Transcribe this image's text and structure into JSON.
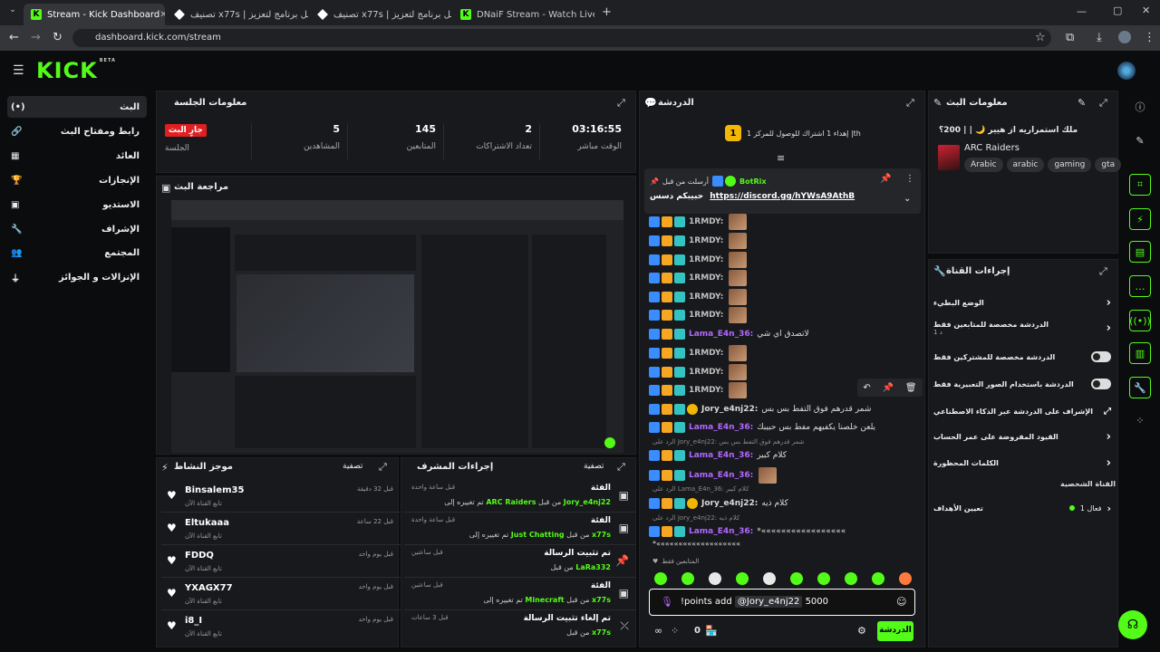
{
  "browser": {
    "tabs": [
      {
        "title": "Stream - Kick Dashboard",
        "icon": "kick-icon"
      },
      {
        "title": "تصنيف x77s | أفضل برنامج لتعزيز",
        "icon": "diamond-icon"
      },
      {
        "title": "تصنيف x77s | أفضل برنامج لتعزيز",
        "icon": "diamond-icon"
      },
      {
        "title": "DNaiF Stream - Watch Live on K",
        "icon": "kick-icon"
      }
    ],
    "url": "dashboard.kick.com/stream"
  },
  "app": {
    "logo": "KICK",
    "logo_tag": "BETA"
  },
  "sidebar": {
    "items": [
      {
        "label": "البث",
        "icon": "live-icon"
      },
      {
        "label": "رابط ومفتاح البث",
        "icon": "link-icon"
      },
      {
        "label": "العائد",
        "icon": "revenue-icon"
      },
      {
        "label": "الإنجازات",
        "icon": "trophy-icon"
      },
      {
        "label": "الاستديو",
        "icon": "studio-icon"
      },
      {
        "label": "الإشراف",
        "icon": "wrench-icon"
      },
      {
        "label": "المجتمع",
        "icon": "community-icon"
      },
      {
        "label": "الإنزالات و الجوائز",
        "icon": "drops-icon"
      }
    ]
  },
  "session": {
    "title": "معلومات الجلسة",
    "live_badge": "جارٍ البث",
    "stats": [
      {
        "value": "03:16:55",
        "label": "الوقت مباشر"
      },
      {
        "value": "2",
        "label": "تعداد الاشتراكات"
      },
      {
        "value": "145",
        "label": "المتابعين"
      },
      {
        "value": "5",
        "label": "المشاهدين"
      },
      {
        "value": "",
        "label": "الجلسة"
      }
    ]
  },
  "preview": {
    "title": "مراجعة البث"
  },
  "activity": {
    "title": "موجز النشاط",
    "filter": "تصفية",
    "items": [
      {
        "name": "Binsalem35",
        "sub": "تابع القناة الآن",
        "time": "قبل 32 دقيقة"
      },
      {
        "name": "Eltukaaa",
        "sub": "تابع القناة الآن",
        "time": "قبل 22 ساعة"
      },
      {
        "name": "FDDQ",
        "sub": "تابع القناة الآن",
        "time": "قبل يوم واحد"
      },
      {
        "name": "YXAGX77",
        "sub": "تابع القناة الآن",
        "time": "قبل يوم واحد"
      },
      {
        "name": "i8_I",
        "sub": "تابع القناة الآن",
        "time": "قبل يوم واحد"
      }
    ]
  },
  "mod_actions": {
    "title": "إجراءات المشرف",
    "filter": "تصفية",
    "items": [
      {
        "title": "الفئة",
        "line_pre": "تم تغييره إلى",
        "highlight": "ARC Raiders",
        "line_post": "من قبل",
        "by": "Jory_e4nj22",
        "time": "قبل ساعة واحدة",
        "icon": "category-icon"
      },
      {
        "title": "الفئة",
        "line_pre": "تم تغييره إلى",
        "highlight": "Just Chatting",
        "line_post": "من قبل",
        "by": "x77s",
        "time": "قبل ساعة واحدة",
        "icon": "category-icon"
      },
      {
        "title": "تم تثبيت الرسالة",
        "line_pre": "",
        "highlight": "",
        "line_post": "من قبل",
        "by": "LaRa332",
        "time": "قبل ساعتين",
        "icon": "pin-icon"
      },
      {
        "title": "الفئة",
        "line_pre": "تم تغييره إلى",
        "highlight": "Minecraft",
        "line_post": "من قبل",
        "by": "x77s",
        "time": "قبل ساعتين",
        "icon": "category-icon"
      },
      {
        "title": "تم إلغاء تثبيت الرسالة",
        "line_pre": "",
        "highlight": "",
        "line_post": "من قبل",
        "by": "x77s",
        "time": "قبل 3 ساعات",
        "icon": "unpin-icon"
      }
    ]
  },
  "chat": {
    "title": "الدردشة",
    "sub_goal": "إهداء 1 اشتراك للوصول للمركز 1 |th",
    "sub_goal_badge": "1",
    "pinned": {
      "label": "أرسلت من قبل",
      "user": "BotRix",
      "text": "حبيبكم دسس",
      "link": "https://discord.gg/hYWsA9AthB"
    },
    "messages": [
      {
        "user": "1RMDY:",
        "text": "",
        "emote": true,
        "color": "#bfbfbf"
      },
      {
        "user": "1RMDY:",
        "text": "",
        "emote": true,
        "color": "#bfbfbf"
      },
      {
        "user": "1RMDY:",
        "text": "",
        "emote": true,
        "color": "#bfbfbf"
      },
      {
        "user": "1RMDY:",
        "text": "",
        "emote": true,
        "color": "#bfbfbf"
      },
      {
        "user": "1RMDY:",
        "text": "",
        "emote": true,
        "color": "#bfbfbf"
      },
      {
        "user": "1RMDY:",
        "text": "",
        "emote": true,
        "color": "#bfbfbf"
      },
      {
        "user": "Lama_E4n_36:",
        "text": "لاتصدق اي شي",
        "emote": false,
        "color": "#b267ff"
      },
      {
        "user": "1RMDY:",
        "text": "",
        "emote": true,
        "color": "#bfbfbf"
      },
      {
        "user": "1RMDY:",
        "text": "",
        "emote": true,
        "color": "#bfbfbf"
      },
      {
        "user": "1RMDY:",
        "text": "",
        "emote": true,
        "color": "#bfbfbf"
      },
      {
        "user": "Jory_e4nj22:",
        "text": "شمر قدرهم فوق التفط بس بس",
        "emote": false,
        "color": "#d9d9d9"
      },
      {
        "user": "Lama_E4n_36:",
        "text": "يلعن خلصنا يكفيهم مفط بس حبيبك",
        "emote": false,
        "color": "#b267ff"
      },
      {
        "user": "Lama_E4n_36:",
        "text": "كلام كبير",
        "emote": false,
        "color": "#b267ff"
      },
      {
        "user": "Lama_E4n_36:",
        "text": "",
        "emote": true,
        "color": "#b267ff"
      },
      {
        "user": "Jory_e4nj22:",
        "text": "كلام ذيه",
        "emote": false,
        "color": "#d9d9d9"
      },
      {
        "user": "Lama_E4n_36:",
        "text": "*«««««««««««««««««",
        "emote": false,
        "color": "#b267ff"
      }
    ],
    "reply1": "الرد على Jory_e4nj22: شمر قدرهم فوق التفط بس بس",
    "reply2": "الرد على Lama_E4n_36: كلام كبير",
    "reply3": "الرد على Jory_e4nj22: كلام ذيه",
    "cont_line": "*«««««««««««««««««««",
    "followers_only": "المتابعين فقط",
    "input": {
      "command": "!points add",
      "mention": "@Jory_e4nj22",
      "amount": "5000"
    },
    "send_label": "الدردشة",
    "viewer_count": "0"
  },
  "stream_info": {
    "title_label": "معلومات البث",
    "title": "ملك استمراريه از هيير 🌙 | | 200؟",
    "category": "ARC Raiders",
    "tags": [
      "Arabic",
      "arabic",
      "gaming",
      "gta"
    ]
  },
  "channel_actions": {
    "title": "إجراءات القناة",
    "rows": [
      {
        "label": "الوضع البطيء",
        "sub": "",
        "control": "chevron"
      },
      {
        "label": "الدردشة مخصصة للمتابعين فقط",
        "sub": "1 د",
        "control": "chevron"
      },
      {
        "label": "الدردشة مخصصة للمشتركين فقط",
        "sub": "",
        "control": "toggle"
      },
      {
        "label": "الدردشة باستخدام الصور التعبيرية فقط",
        "sub": "",
        "control": "toggle"
      },
      {
        "label": "الإشراف على الدردشة عبر الذكاء الاصطناعي",
        "sub": "",
        "control": "external"
      },
      {
        "label": "القيود المفروضة على عمر الحساب",
        "sub": "",
        "control": "chevron"
      },
      {
        "label": "الكلمات المحظورة",
        "sub": "",
        "control": "chevron"
      }
    ],
    "section": "القناة الشخصية",
    "goals": {
      "label": "تعيين الأهداف",
      "status": "فعال 1"
    }
  },
  "colors": {
    "accent": "#53fc18",
    "live": "#e02020",
    "panel": "#18191c",
    "background": "#0b0c0e"
  }
}
